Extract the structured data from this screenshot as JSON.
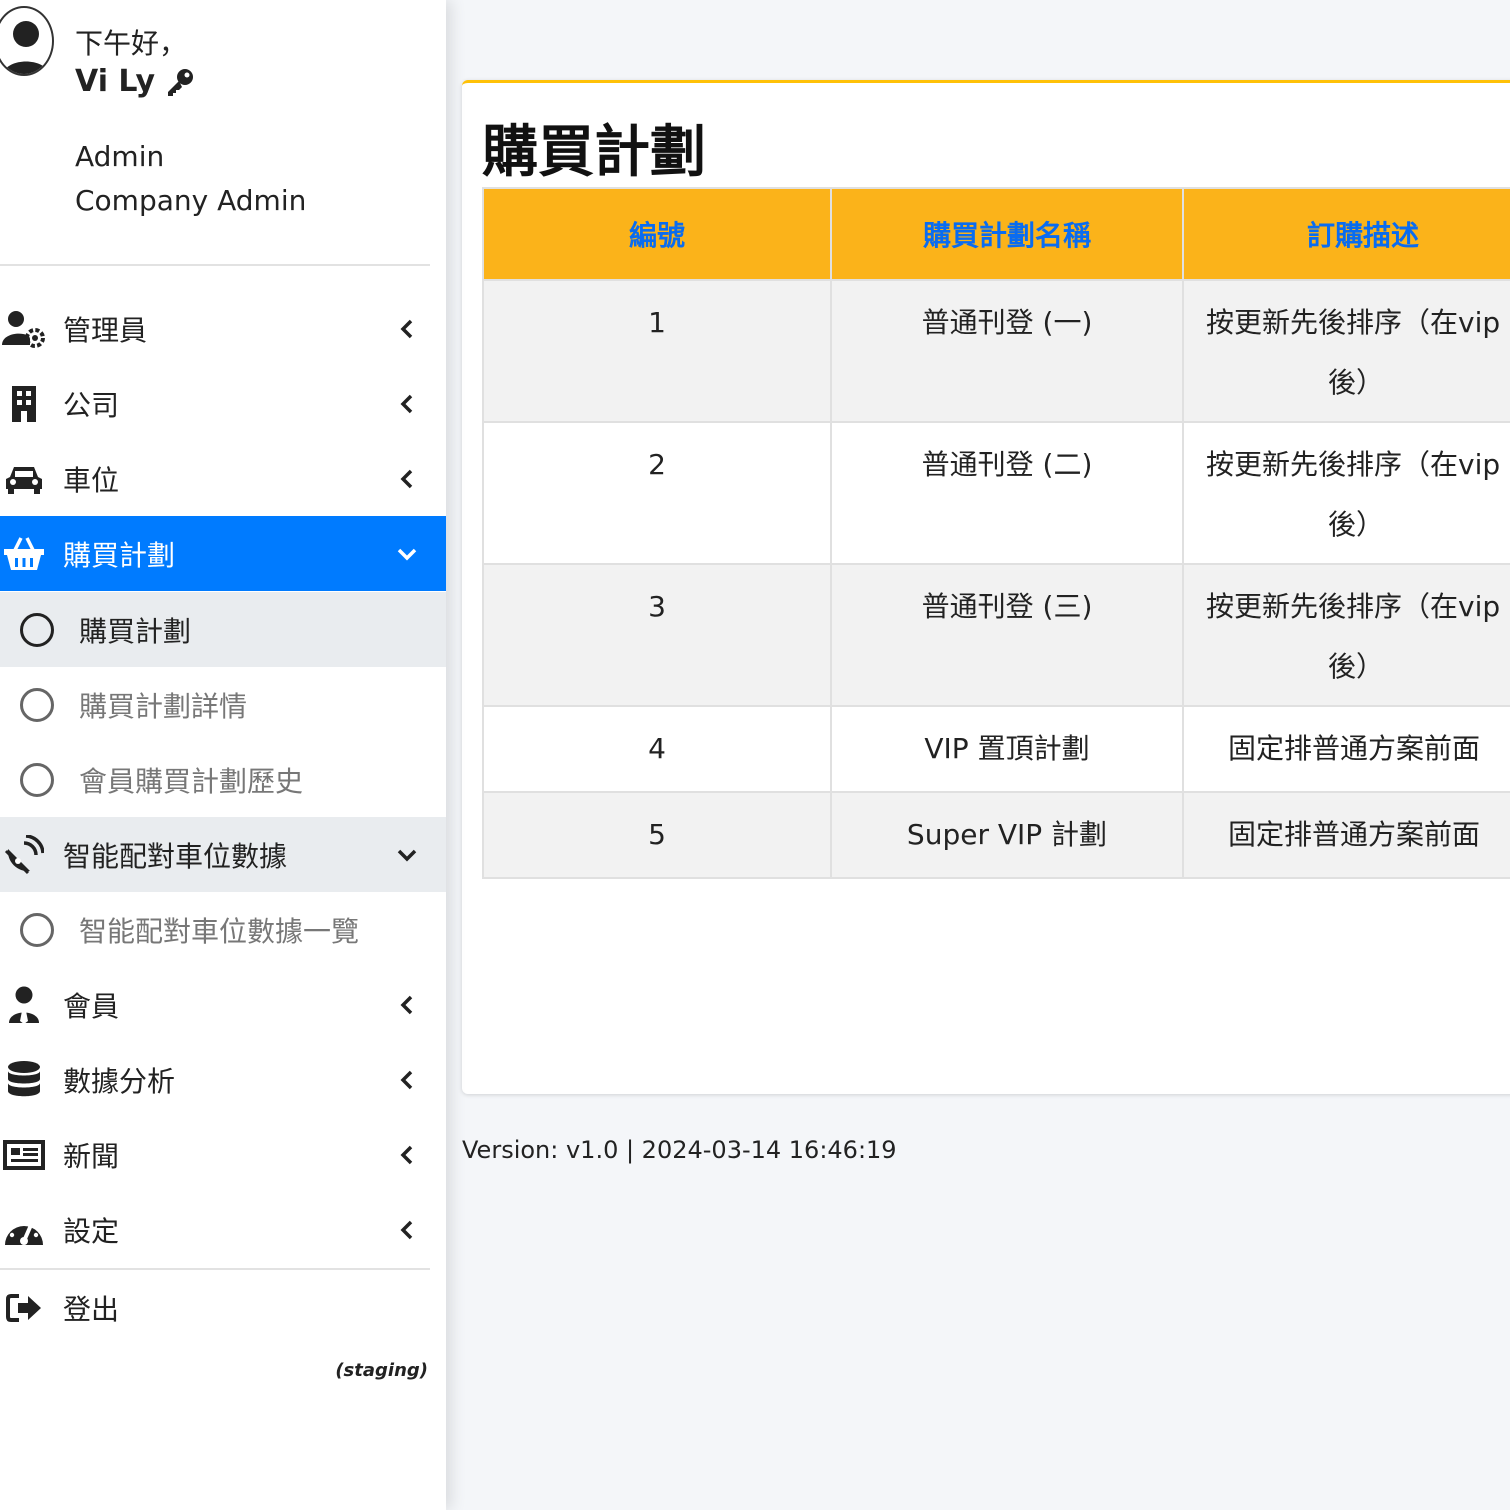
{
  "user": {
    "greeting": "下午好，",
    "name": "Vi Ly",
    "role_line1": "Admin",
    "role_line2": "Company Admin"
  },
  "nav": {
    "admins": "管理員",
    "company": "公司",
    "parking": "車位",
    "plans": "購買計劃",
    "plans_sub": [
      "購買計劃",
      "購買計劃詳情",
      "會員購買計劃歷史"
    ],
    "smart": "智能配對車位數據",
    "smart_sub": [
      "智能配對車位數據一覽"
    ],
    "members": "會員",
    "analytics": "數據分析",
    "news": "新聞",
    "settings": "設定",
    "logout": "登出"
  },
  "env_label": "(staging)",
  "page": {
    "title": "購買計劃",
    "columns": [
      "編號",
      "購買計劃名稱",
      "訂購描述"
    ],
    "rows": [
      {
        "id": "1",
        "name": "普通刊登 (一)",
        "desc1": "按更新先後排序（在vip",
        "desc2": "後）"
      },
      {
        "id": "2",
        "name": "普通刊登 (二)",
        "desc1": "按更新先後排序（在vip",
        "desc2": "後）"
      },
      {
        "id": "3",
        "name": "普通刊登 (三)",
        "desc1": "按更新先後排序（在vip",
        "desc2": "後）"
      },
      {
        "id": "4",
        "name": "VIP 置頂計劃",
        "desc1": "固定排普通方案前面",
        "desc2": ""
      },
      {
        "id": "5",
        "name": "Super VIP 計劃",
        "desc1": "固定排普通方案前面",
        "desc2": ""
      }
    ]
  },
  "footer": {
    "version": "Version: v1.0 | 2024-03-14 16:46:19"
  },
  "colors": {
    "active": "#007bff",
    "header_bg": "#fbb31a",
    "header_text": "#0a6cf0",
    "card_accent": "#ffc107"
  }
}
